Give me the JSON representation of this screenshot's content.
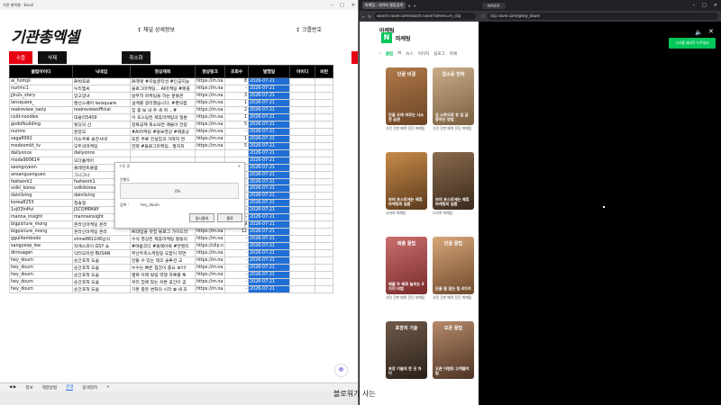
{
  "excel": {
    "title": "기관 총엑셀 · Excel",
    "brand": "기관총엑셀",
    "info_detail": "↕ 채널 상세정보",
    "info_clubno": "↕ 크롭번호",
    "buttons": {
      "collect": "수줍",
      "delete": "삭제",
      "cancel": "취소화"
    },
    "headers": [
      "클럽아이디",
      "닉네임",
      "영상제목",
      "영상링크",
      "조회수",
      "발행일",
      "아이디",
      "비번"
    ],
    "rows": [
      [
        "ai_hompi",
        "AI박프로",
        "AI챗봇 #지동글작성 #인공지능",
        "https://m.na",
        "8",
        "2026-07-21"
      ],
      [
        "nurimc1",
        "누리엠씨",
        "블로그마케팅... AI마케팅 #매출",
        "https://m.na",
        "-",
        "2026-07-21"
      ],
      [
        "jjin2s_story",
        "앙고앙녀",
        "방무히 마케팅을 하는 분들은",
        "https://m.na",
        "3",
        "2026-07-21"
      ],
      [
        "lansquare_",
        "랜선스퀘어 lansquare",
        "설계를 정리했습니다. #편의점",
        "https://m.na",
        "1",
        "2026-07-21"
      ],
      [
        "realreview_tasty",
        "realreviewofficial",
        "집 종 보 내 주 세 여 .. #",
        "https://m.na",
        "2",
        "2026-07-21"
      ],
      [
        "cold-noodles",
        "대물리5409",
        "이 포스팅은 제휴마케팅의 일환",
        "https://m.na",
        "1",
        "2026-07-21"
      ],
      [
        "godofbuilding",
        "빌딩의 신",
        "창북공제 축소되면 매물이 전망",
        "https://m.na",
        "5",
        "2026-07-21"
      ],
      [
        "nurimc",
        "분양모",
        "#AI마케팅 #홍보영상 #매출상",
        "https://m.na",
        "-",
        "2026-07-21"
      ],
      [
        "saga8992",
        "미소주류 솔잔샤네",
        "또한 주류 전설집과 거래처 연",
        "https://m.na",
        "1",
        "2026-07-21"
      ],
      [
        "modoomkt_tv",
        "모두의마케팅",
        "전략 #블로그마케팅.. 팔지피",
        "https://m.na",
        "5",
        "2026-07-21"
      ],
      [
        "dailyonce",
        "dailyonce",
        "",
        "",
        "",
        "2026-07-21"
      ],
      [
        "moda900614",
        "모다홀케어",
        "",
        "",
        "",
        "2026-07-21"
      ],
      [
        "seongsyeon",
        "플레먼트클럽",
        "",
        "",
        "",
        "2026-07-21"
      ],
      [
        "ansanguenguen",
        "그니그니",
        "",
        "",
        "",
        "2026-07-21"
      ],
      [
        "fastwork1",
        "fastwork1",
        "",
        "",
        "",
        "2026-07-21"
      ],
      [
        "volki_korea",
        "volkikorea",
        "",
        "",
        "",
        "2026-07-21"
      ],
      [
        "dainliving",
        "dainliving",
        "",
        "",
        "",
        "2026-07-21"
      ],
      [
        "korea8255",
        "청솔정",
        "",
        "",
        "",
        "2026-07-21"
      ],
      [
        "1vj03h4fvi",
        "JSCOMPANY",
        "어떤 #네이버블레이스 #마케팅",
        "https://m.na",
        "-",
        "2026-07-21"
      ],
      [
        "manna_insight",
        "mannainsight",
        "중국 매체탐 유입 자료구가 점",
        "https://m.na",
        "-",
        "2026-07-21"
      ],
      [
        "bigpicture_mong",
        "온라인마케팅 온라",
        "AI대입을 맛집 블로그 가이드라",
        "https://m.na",
        "9",
        "2026-07-21"
      ],
      [
        "bigpicture_mong",
        "온라인마케팅 온라",
        "AI대입을 맛집 블로그 가이드라",
        "https://m.na",
        "12",
        "2026-07-21"
      ],
      [
        "ggulitembodo",
        "shine881106님의",
        "수석 영상은 제휴마케팅 활동의",
        "https://m.na",
        "-",
        "2026-07-21"
      ],
      [
        "sangyeop_lee",
        "지에스와이 GSY 쇼",
        "#여름코디 #홈웨어룩 #면텐티",
        "https://clip.n",
        "-",
        "2026-07-21"
      ],
      [
        "dirnoagen",
        "닥터오미엔 BUSAN",
        "부산두피스케일링 오꿈이 약연",
        "https://m.na",
        "-",
        "2026-07-21"
      ],
      [
        "hey_doum",
        "순간포착 도움",
        "만들 수 있는 레코 솔루션 교",
        "https://m.na",
        "-",
        "2026-07-21"
      ],
      [
        "hey_doum",
        "순간포착 도움",
        "누수는 빠른 점검이 중요 보이!",
        "https://m.na",
        "-",
        "2026-07-21"
      ],
      [
        "hey_doum",
        "순간포착 도움",
        "별목 아래 릴링 역행 하루를 톡",
        "https://m.na",
        "-",
        "2026-07-21"
      ],
      [
        "hey_doum",
        "순간포착 도움",
        "우리 집에 맞는 커튼 공간이 공",
        "https://m.na",
        "-",
        "2026-07-21"
      ],
      [
        "hey_doum",
        "순간포착 도움",
        "기본 충은 변화의 시작 ✿ 새 조",
        "https://m.na",
        "-",
        "2026-07-21"
      ]
    ],
    "sheet_tabs": [
      "정보",
      "해끌방법",
      "문멤",
      "탐색정려"
    ],
    "modal": {
      "title": "수동 중",
      "label": "진행도",
      "percent": "0%",
      "row_label": "검색 :",
      "row_value": "hey_doum",
      "btn_pause": "일시중지",
      "btn_stop": "종료"
    }
  },
  "browser": {
    "tabs": [
      "마케팅 : 네이버 클립검색",
      "x",
      "+"
    ],
    "url": "search.naver.com/search.naver?where=m_clip",
    "header": "아케팅",
    "brand_title": "마케팅",
    "nav_tabs": [
      "클립",
      "AI",
      "뉴스",
      "이미지",
      "블로그",
      "카페"
    ],
    "cards": [
      {
        "tag": "단골 비결",
        "caption": "단골 오래 머무는 사소한 습관",
        "meta": "고민 간판 매력 진단 마케팅"
      },
      {
        "tag": "입소문 전략",
        "caption": "입 소문으로 유 입 급증하는 방법",
        "meta": "고민 간판 매력 진단 마케팅"
      },
      {
        "tag": "",
        "caption": "보여 포스트에는 제휴마케팅의 일환",
        "meta": "나라카 마케팅"
      },
      {
        "tag": "",
        "caption": "보여 포스트에는 제휴마케팅의 일환",
        "meta": "나라카 마케팅"
      },
      {
        "tag": "매출 꿀팁",
        "caption": "매출 두 배로 늘리는 3가지 비법",
        "meta": "고민 간판 매력 진단 마케팅"
      },
      {
        "tag": "단골 꿀팁",
        "caption": "단골 잘 잡는 팁 4가지",
        "meta": "고민 간판 매력 진단 마케팅"
      },
      {
        "tag": "포장의 기술",
        "caption": "포장 기술의 한 끗 차이",
        "meta": ""
      },
      {
        "tag": "오픈 꿀팁",
        "caption": "오픈 이벤트 고객몰이 팁",
        "meta": ""
      }
    ]
  },
  "dark_browser": {
    "tab": "NAVER",
    "url": "clip.naver.com/@hey_doum",
    "green_button": "소리를 제대로 누르세요"
  },
  "subtitle": "블로워가 사는"
}
